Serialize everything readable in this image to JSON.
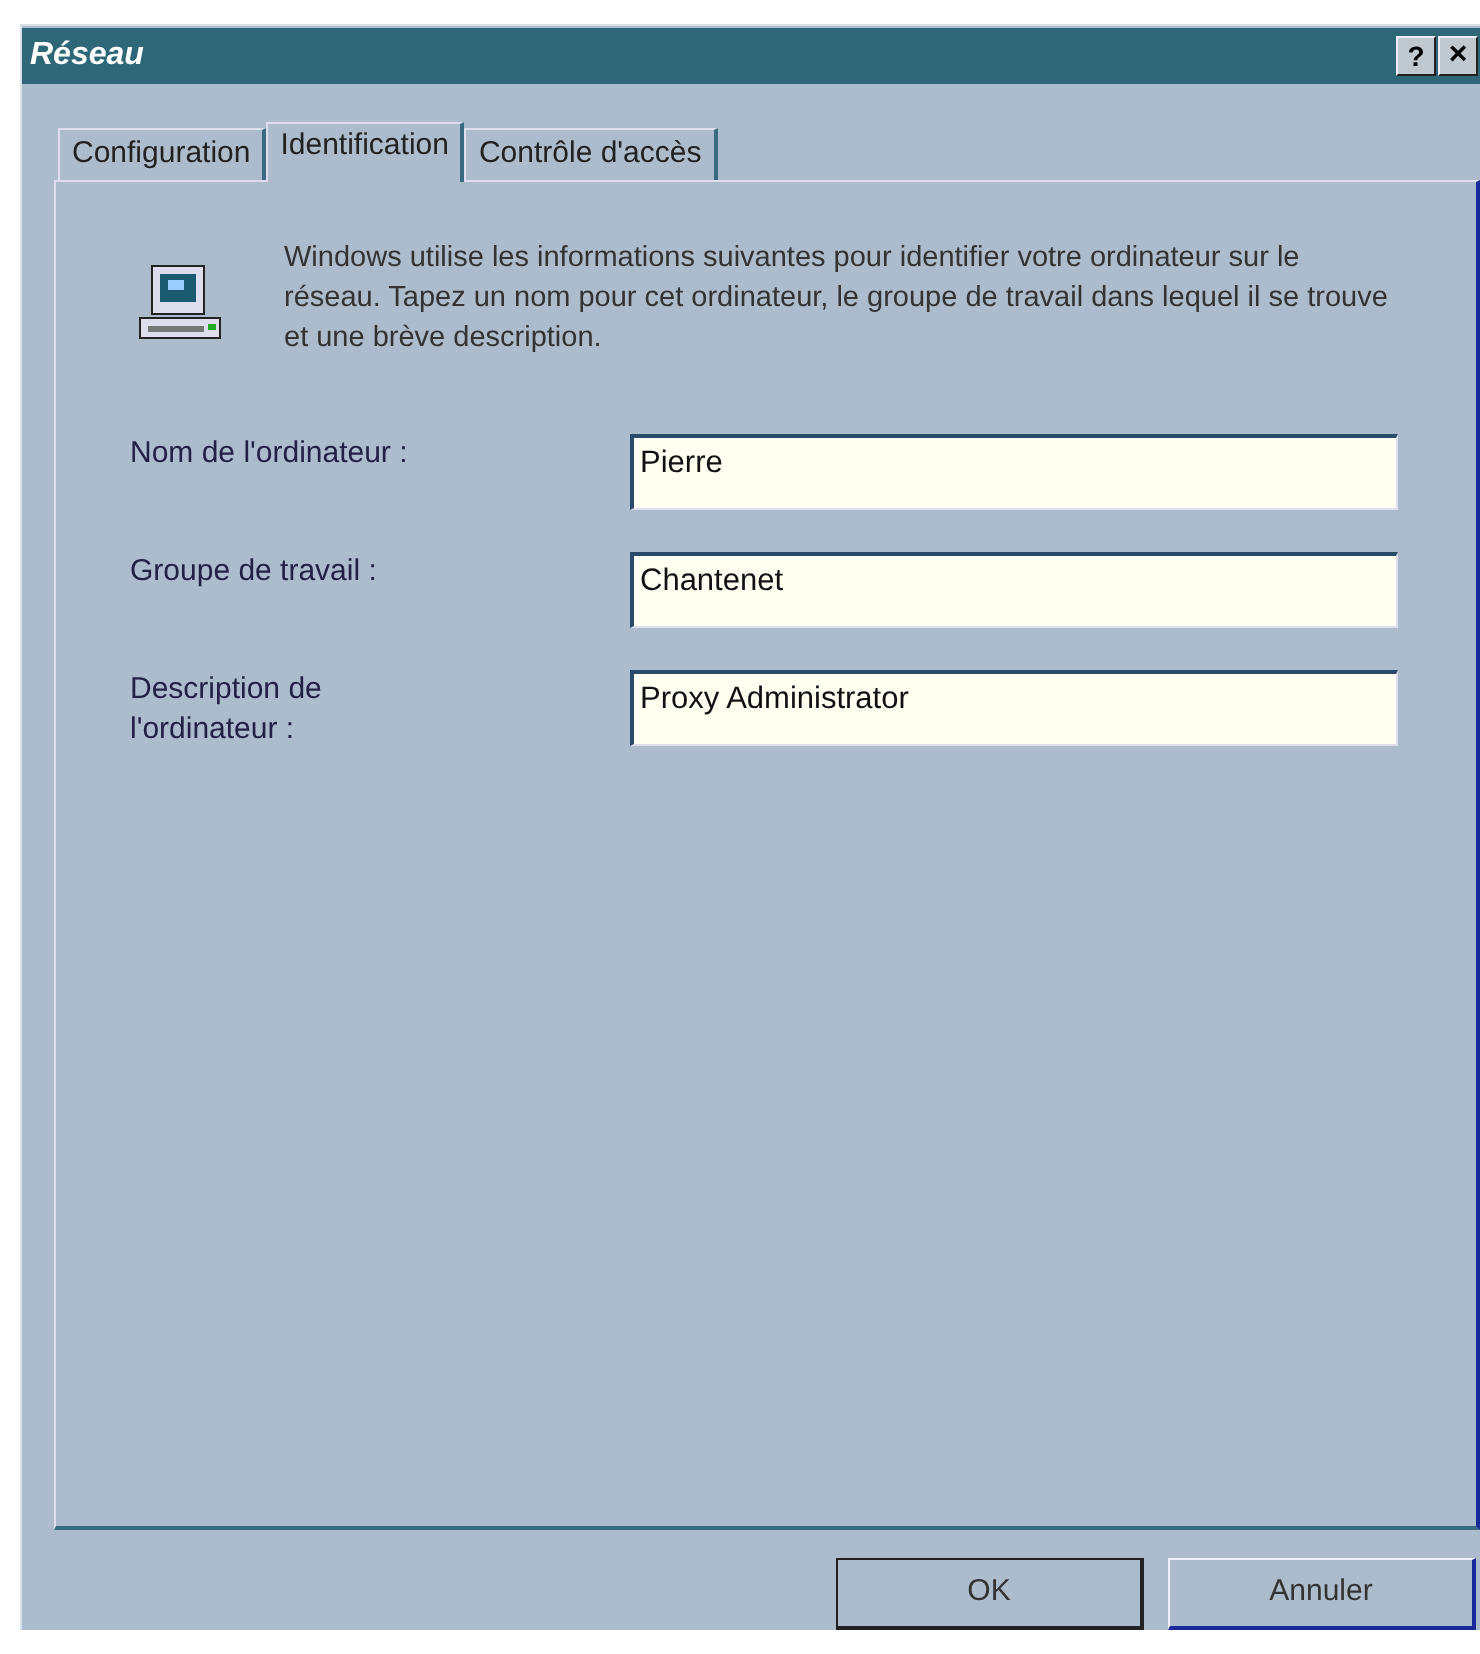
{
  "window": {
    "title": "Réseau",
    "help_button": "?",
    "close_button": "×"
  },
  "tabs": [
    {
      "label": "Configuration",
      "selected": false
    },
    {
      "label": "Identification",
      "selected": true
    },
    {
      "label": "Contrôle d'accès",
      "selected": false
    }
  ],
  "intro": "Windows utilise les informations suivantes pour identifier votre ordinateur sur le réseau. Tapez un nom pour cet ordinateur, le groupe de travail dans lequel il se trouve et une brève description.",
  "fields": [
    {
      "label": "Nom de l'ordinateur :",
      "value": "Pierre"
    },
    {
      "label": "Groupe de travail :",
      "value": "Chantenet"
    },
    {
      "label": "Description de l'ordinateur :",
      "value": "Proxy Administrator"
    }
  ],
  "buttons": [
    {
      "label": "OK",
      "default": true
    },
    {
      "label": "Annuler",
      "default": false
    }
  ]
}
